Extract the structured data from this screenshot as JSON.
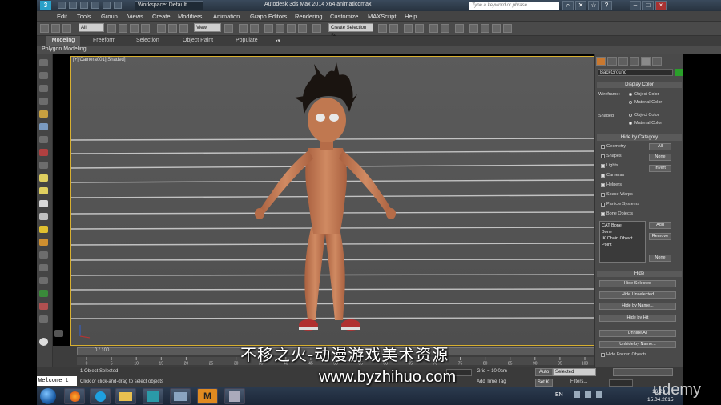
{
  "titlebar": {
    "workspace": "Workspace: Default",
    "document_title": "Autodesk 3ds Max 2014 x64     animaticdmax",
    "search_placeholder": "Type a keyword or phrase"
  },
  "menu": [
    "Edit",
    "Tools",
    "Group",
    "Views",
    "Create",
    "Modifiers",
    "Animation",
    "Graph Editors",
    "Rendering",
    "Customize",
    "MAXScript",
    "Help"
  ],
  "toolbar": {
    "filter_value": "All",
    "refcoord_value": "View",
    "selection_set": "Create Selection Se"
  },
  "ribbon": {
    "tabs": [
      "Modeling",
      "Freeform",
      "Selection",
      "Object Paint",
      "Populate"
    ],
    "sub_label": "Polygon Modeling"
  },
  "viewport": {
    "label": "[+][Camera001][Shaded]"
  },
  "command_panel": {
    "name_field": "BackGround",
    "display_color": {
      "title": "Display Color",
      "wireframe_label": "Wireframe:",
      "shaded_label": "Shaded:",
      "object_color": "Object Color",
      "material_color": "Material Color"
    },
    "hide_by_category": {
      "title": "Hide by Category",
      "items": [
        "Geometry",
        "Shapes",
        "Lights",
        "Cameras",
        "Helpers",
        "Space Warps",
        "Particle Systems",
        "Bone Objects"
      ],
      "btn_all": "All",
      "btn_none": "None",
      "btn_invert": "Invert",
      "list": [
        "CAT Bone",
        "Bone",
        "IK Chain Object",
        "Point"
      ],
      "btn_add": "Add",
      "btn_remove": "Remove",
      "btn_none2": "None"
    },
    "hide": {
      "title": "Hide",
      "buttons": [
        "Hide Selected",
        "Hide Unselected",
        "Hide by Name...",
        "Hide by Hit",
        "Unhide All",
        "Unhide by Name..."
      ],
      "checkbox": "Hide Frozen Objects"
    }
  },
  "timeline": {
    "frame": "0 / 100",
    "ticks": [
      "0",
      "5",
      "10",
      "15",
      "20",
      "25",
      "30",
      "35",
      "40",
      "45",
      "50",
      "55",
      "60",
      "65",
      "70",
      "75",
      "80",
      "85",
      "90",
      "95",
      "100"
    ]
  },
  "status": {
    "listener": "Welcome t",
    "selection": "1 Object Selected",
    "prompt": "Click or click-and-drag to select objects",
    "grid": "Grid = 10,0cm",
    "add_time_tag": "Add Time Tag",
    "auto": "Auto",
    "set_k": "Set K.",
    "selected": "Selected",
    "filters": "Filters..."
  },
  "taskbar": {
    "lang": "EN",
    "time": "16:23",
    "date": "15.04.2015",
    "max_app_label": "M"
  },
  "overlay": {
    "watermark_cn": "不移之火-动漫游戏美术资源",
    "watermark_url": "www.byzhihuo.com",
    "udemy": "udemy"
  },
  "colors": {
    "viewport_bg": "#5b5b5b",
    "viewport_border": "#d8b030",
    "skin": "#c9805a",
    "hair": "#1a1410"
  }
}
